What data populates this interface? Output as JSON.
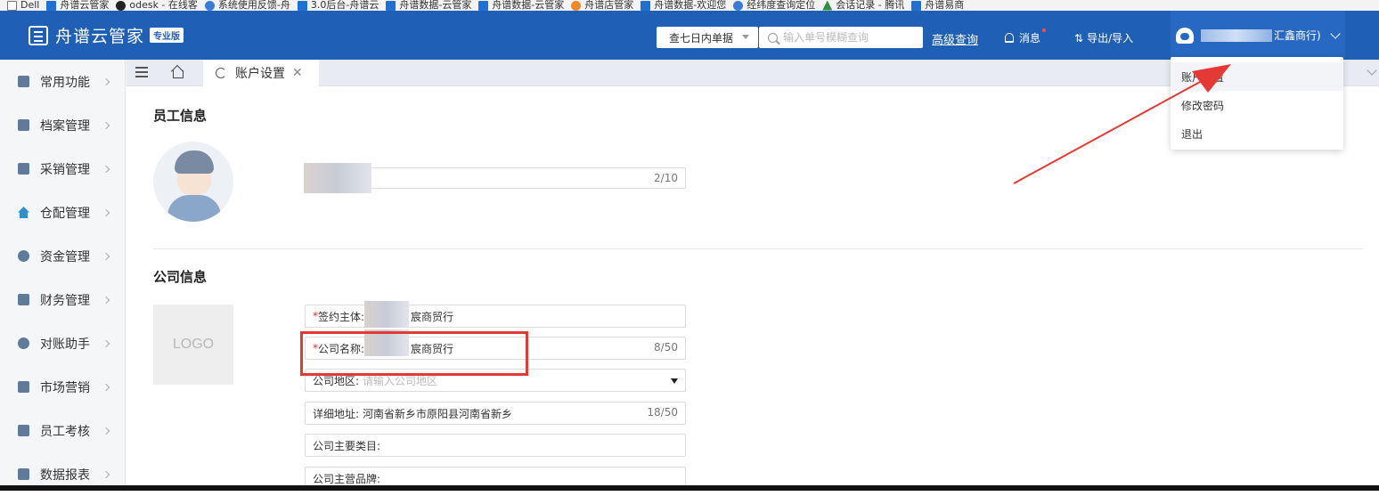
{
  "bookmarks": [
    {
      "label": "Dell",
      "icon": "box"
    },
    {
      "label": "舟谱云管家",
      "icon": "blue"
    },
    {
      "label": "odesk - 在线客",
      "icon": "dark"
    },
    {
      "label": "系统使用反馈-舟",
      "icon": "round"
    },
    {
      "label": "3.0后台-舟谱云",
      "icon": "blue"
    },
    {
      "label": "舟谱数据-云管家",
      "icon": "blue"
    },
    {
      "label": "舟谱数据-云管家",
      "icon": "blue"
    },
    {
      "label": "舟谱店管家",
      "icon": "orange"
    },
    {
      "label": "舟谱数据-欢迎您",
      "icon": "blue"
    },
    {
      "label": "经纬度查询定位",
      "icon": "round"
    },
    {
      "label": "会话记录 - 腾讯",
      "icon": "green"
    },
    {
      "label": "舟谱易商",
      "icon": "blue"
    }
  ],
  "header": {
    "app_title": "舟谱云管家",
    "edition_badge": "专业版",
    "range_select": "查七日内单据",
    "search_placeholder": "输入单号模糊查询",
    "advanced_search": "高级查询",
    "messages": "消息",
    "export_import": "导出/导入",
    "user_name_suffix": "汇鑫商行)"
  },
  "sidebar": {
    "items": [
      {
        "label": "常用功能",
        "icon": "frequent-icon"
      },
      {
        "label": "档案管理",
        "icon": "archive-icon"
      },
      {
        "label": "采销管理",
        "icon": "purchase-sales-icon"
      },
      {
        "label": "仓配管理",
        "icon": "warehouse-icon"
      },
      {
        "label": "资金管理",
        "icon": "funds-icon"
      },
      {
        "label": "财务管理",
        "icon": "finance-icon"
      },
      {
        "label": "对账助手",
        "icon": "reconcile-icon"
      },
      {
        "label": "市场营销",
        "icon": "marketing-icon"
      },
      {
        "label": "员工考核",
        "icon": "staff-icon"
      },
      {
        "label": "数据报表",
        "icon": "report-icon"
      }
    ]
  },
  "tabs": {
    "active_tab": "账户设置",
    "close_glyph": "✕"
  },
  "employee": {
    "section_title": "员工信息",
    "name_counter": "2/10"
  },
  "company": {
    "section_title": "公司信息",
    "logo_label": "LOGO",
    "contract_entity_label": "签约主体:",
    "contract_entity_value": "宸商贸行",
    "company_name_label": "公司名称:",
    "company_name_value": "宸商贸行",
    "company_name_counter": "8/50",
    "region_label": "公司地区:",
    "region_placeholder": "请输入公司地区",
    "address_label": "详细地址:",
    "address_value": "河南省新乡市原阳县河南省新乡",
    "address_counter": "18/50",
    "category_label": "公司主要类目:",
    "brand_label": "公司主营品牌:",
    "required_mark": "*"
  },
  "user_menu": {
    "items": [
      "账户设置",
      "修改密码",
      "退出"
    ]
  },
  "colors": {
    "header_blue": "#1f5fb5",
    "accent_red": "#e53935"
  }
}
